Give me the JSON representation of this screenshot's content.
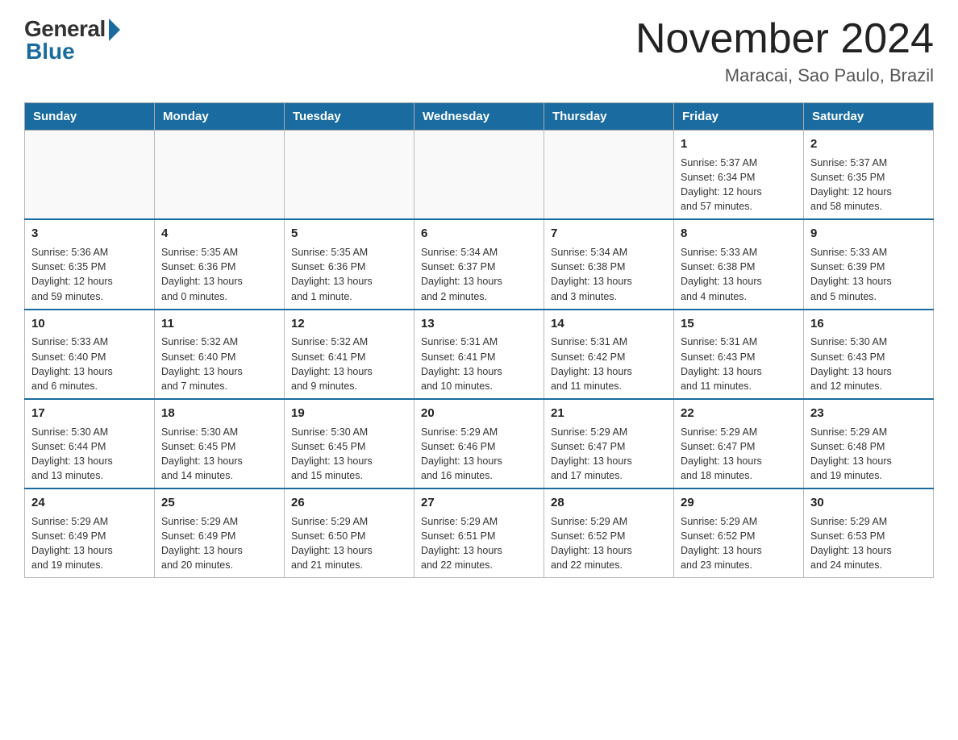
{
  "logo": {
    "general": "General",
    "blue": "Blue"
  },
  "title": "November 2024",
  "subtitle": "Maracai, Sao Paulo, Brazil",
  "days": [
    "Sunday",
    "Monday",
    "Tuesday",
    "Wednesday",
    "Thursday",
    "Friday",
    "Saturday"
  ],
  "weeks": [
    [
      {
        "day": "",
        "info": ""
      },
      {
        "day": "",
        "info": ""
      },
      {
        "day": "",
        "info": ""
      },
      {
        "day": "",
        "info": ""
      },
      {
        "day": "",
        "info": ""
      },
      {
        "day": "1",
        "info": "Sunrise: 5:37 AM\nSunset: 6:34 PM\nDaylight: 12 hours\nand 57 minutes."
      },
      {
        "day": "2",
        "info": "Sunrise: 5:37 AM\nSunset: 6:35 PM\nDaylight: 12 hours\nand 58 minutes."
      }
    ],
    [
      {
        "day": "3",
        "info": "Sunrise: 5:36 AM\nSunset: 6:35 PM\nDaylight: 12 hours\nand 59 minutes."
      },
      {
        "day": "4",
        "info": "Sunrise: 5:35 AM\nSunset: 6:36 PM\nDaylight: 13 hours\nand 0 minutes."
      },
      {
        "day": "5",
        "info": "Sunrise: 5:35 AM\nSunset: 6:36 PM\nDaylight: 13 hours\nand 1 minute."
      },
      {
        "day": "6",
        "info": "Sunrise: 5:34 AM\nSunset: 6:37 PM\nDaylight: 13 hours\nand 2 minutes."
      },
      {
        "day": "7",
        "info": "Sunrise: 5:34 AM\nSunset: 6:38 PM\nDaylight: 13 hours\nand 3 minutes."
      },
      {
        "day": "8",
        "info": "Sunrise: 5:33 AM\nSunset: 6:38 PM\nDaylight: 13 hours\nand 4 minutes."
      },
      {
        "day": "9",
        "info": "Sunrise: 5:33 AM\nSunset: 6:39 PM\nDaylight: 13 hours\nand 5 minutes."
      }
    ],
    [
      {
        "day": "10",
        "info": "Sunrise: 5:33 AM\nSunset: 6:40 PM\nDaylight: 13 hours\nand 6 minutes."
      },
      {
        "day": "11",
        "info": "Sunrise: 5:32 AM\nSunset: 6:40 PM\nDaylight: 13 hours\nand 7 minutes."
      },
      {
        "day": "12",
        "info": "Sunrise: 5:32 AM\nSunset: 6:41 PM\nDaylight: 13 hours\nand 9 minutes."
      },
      {
        "day": "13",
        "info": "Sunrise: 5:31 AM\nSunset: 6:41 PM\nDaylight: 13 hours\nand 10 minutes."
      },
      {
        "day": "14",
        "info": "Sunrise: 5:31 AM\nSunset: 6:42 PM\nDaylight: 13 hours\nand 11 minutes."
      },
      {
        "day": "15",
        "info": "Sunrise: 5:31 AM\nSunset: 6:43 PM\nDaylight: 13 hours\nand 11 minutes."
      },
      {
        "day": "16",
        "info": "Sunrise: 5:30 AM\nSunset: 6:43 PM\nDaylight: 13 hours\nand 12 minutes."
      }
    ],
    [
      {
        "day": "17",
        "info": "Sunrise: 5:30 AM\nSunset: 6:44 PM\nDaylight: 13 hours\nand 13 minutes."
      },
      {
        "day": "18",
        "info": "Sunrise: 5:30 AM\nSunset: 6:45 PM\nDaylight: 13 hours\nand 14 minutes."
      },
      {
        "day": "19",
        "info": "Sunrise: 5:30 AM\nSunset: 6:45 PM\nDaylight: 13 hours\nand 15 minutes."
      },
      {
        "day": "20",
        "info": "Sunrise: 5:29 AM\nSunset: 6:46 PM\nDaylight: 13 hours\nand 16 minutes."
      },
      {
        "day": "21",
        "info": "Sunrise: 5:29 AM\nSunset: 6:47 PM\nDaylight: 13 hours\nand 17 minutes."
      },
      {
        "day": "22",
        "info": "Sunrise: 5:29 AM\nSunset: 6:47 PM\nDaylight: 13 hours\nand 18 minutes."
      },
      {
        "day": "23",
        "info": "Sunrise: 5:29 AM\nSunset: 6:48 PM\nDaylight: 13 hours\nand 19 minutes."
      }
    ],
    [
      {
        "day": "24",
        "info": "Sunrise: 5:29 AM\nSunset: 6:49 PM\nDaylight: 13 hours\nand 19 minutes."
      },
      {
        "day": "25",
        "info": "Sunrise: 5:29 AM\nSunset: 6:49 PM\nDaylight: 13 hours\nand 20 minutes."
      },
      {
        "day": "26",
        "info": "Sunrise: 5:29 AM\nSunset: 6:50 PM\nDaylight: 13 hours\nand 21 minutes."
      },
      {
        "day": "27",
        "info": "Sunrise: 5:29 AM\nSunset: 6:51 PM\nDaylight: 13 hours\nand 22 minutes."
      },
      {
        "day": "28",
        "info": "Sunrise: 5:29 AM\nSunset: 6:52 PM\nDaylight: 13 hours\nand 22 minutes."
      },
      {
        "day": "29",
        "info": "Sunrise: 5:29 AM\nSunset: 6:52 PM\nDaylight: 13 hours\nand 23 minutes."
      },
      {
        "day": "30",
        "info": "Sunrise: 5:29 AM\nSunset: 6:53 PM\nDaylight: 13 hours\nand 24 minutes."
      }
    ]
  ]
}
